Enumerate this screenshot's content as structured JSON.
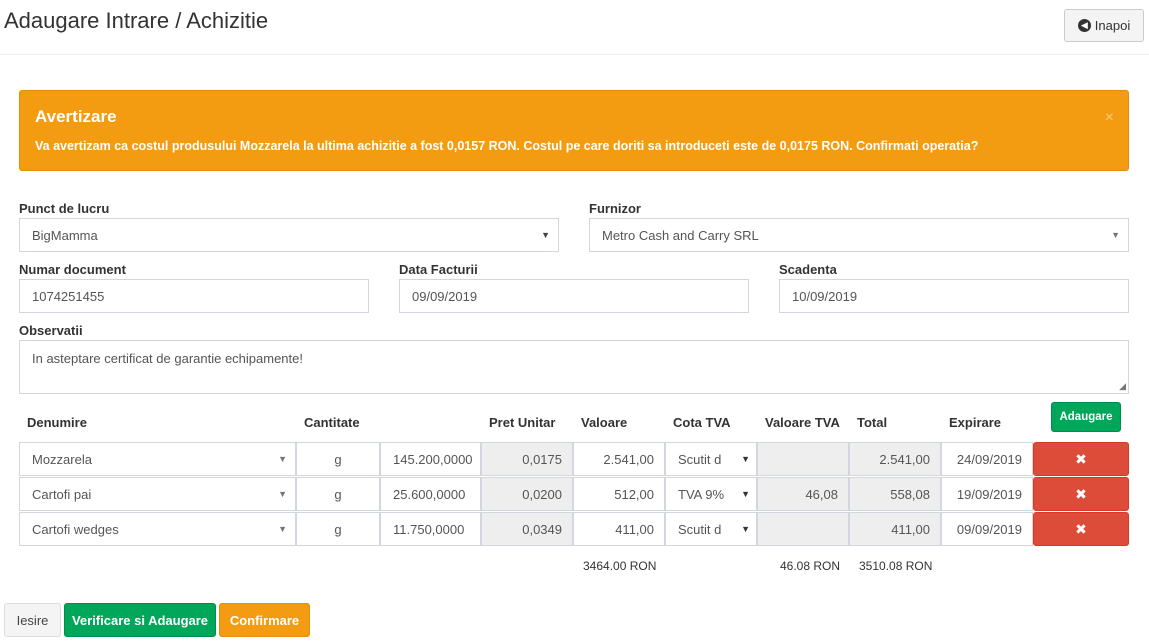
{
  "header": {
    "title": "Adaugare Intrare / Achizitie",
    "back_label": "Inapoi"
  },
  "alert": {
    "title": "Avertizare",
    "message": "Va avertizam ca costul produsului Mozzarela la ultima achizitie a fost 0,0157 RON. Costul pe care doriti sa introduceti este de 0,0175 RON. Confirmati operatia?",
    "close": "×"
  },
  "form": {
    "punct_label": "Punct de lucru",
    "punct_value": "BigMamma",
    "furnizor_label": "Furnizor",
    "furnizor_value": "Metro Cash and Carry SRL",
    "numar_label": "Numar document",
    "numar_value": "1074251455",
    "data_label": "Data Facturii",
    "data_value": "09/09/2019",
    "scadenta_label": "Scadenta",
    "scadenta_value": "10/09/2019",
    "obs_label": "Observatii",
    "obs_value": "In asteptare certificat de garantie echipamente!"
  },
  "table": {
    "headers": {
      "denumire": "Denumire",
      "cantitate": "Cantitate",
      "pret": "Pret Unitar",
      "valoare": "Valoare",
      "cota": "Cota TVA",
      "valoare_tva": "Valoare TVA",
      "total": "Total",
      "expirare": "Expirare"
    },
    "add_label": "Adaugare",
    "rows": [
      {
        "name": "Mozzarela",
        "unit": "g",
        "qty": "145.200,0000",
        "price": "0,0175",
        "value": "2.541,00",
        "tva": "Scutit d",
        "tva_value": "",
        "total": "2.541,00",
        "expiry": "24/09/2019"
      },
      {
        "name": "Cartofi pai",
        "unit": "g",
        "qty": "25.600,0000",
        "price": "0,0200",
        "value": "512,00",
        "tva": "TVA 9%",
        "tva_value": "46,08",
        "total": "558,08",
        "expiry": "19/09/2019"
      },
      {
        "name": "Cartofi wedges",
        "unit": "g",
        "qty": "11.750,0000",
        "price": "0,0349",
        "value": "411,00",
        "tva": "Scutit d",
        "tva_value": "",
        "total": "411,00",
        "expiry": "09/09/2019"
      }
    ],
    "totals": {
      "valoare": "3464.00 RON",
      "tva": "46.08 RON",
      "total": "3510.08 RON"
    }
  },
  "footer": {
    "iesire": "Iesire",
    "verificare": "Verificare si Adaugare",
    "confirmare": "Confirmare"
  },
  "icons": {
    "back": "arrow-circle-left-icon",
    "delete": "times-icon",
    "dropdown": "caret-down-icon"
  },
  "colors": {
    "warning": "#f39c12",
    "success": "#00a65a",
    "danger": "#dd4b39"
  }
}
